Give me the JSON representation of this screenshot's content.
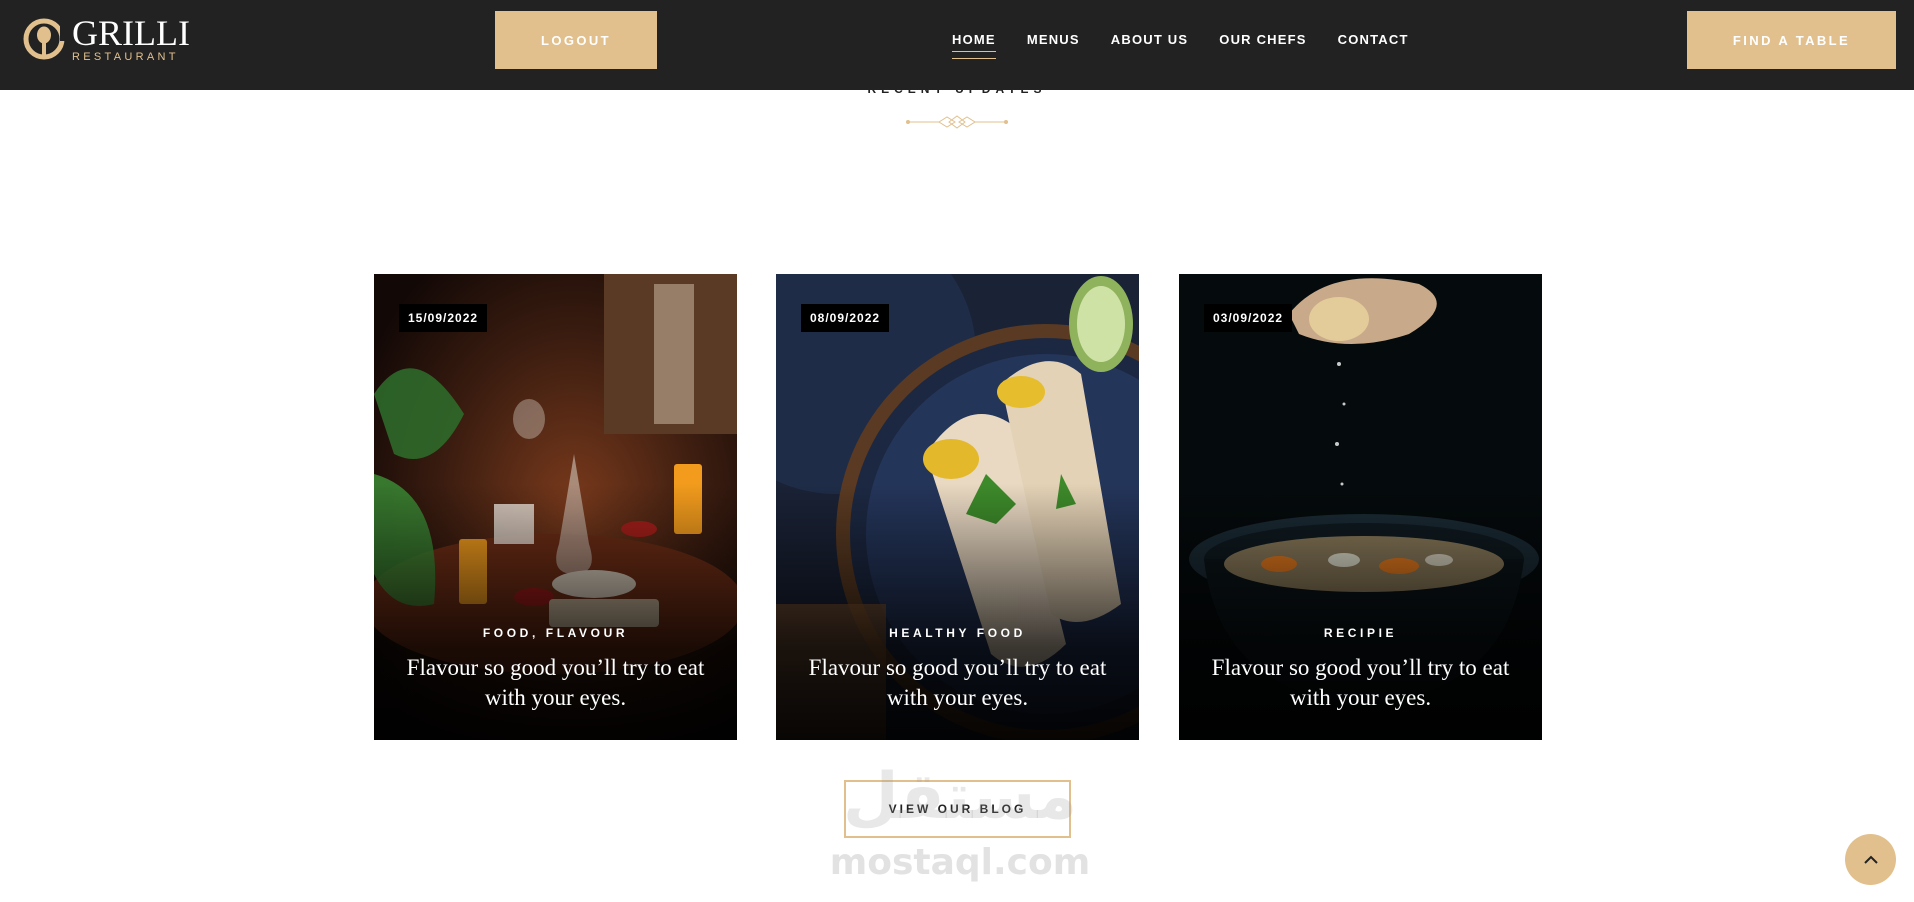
{
  "header": {
    "logo": {
      "name": "GRILLI",
      "subtitle": "RESTAURANT"
    },
    "logout_label": "LOGOUT",
    "nav": [
      {
        "label": "HOME",
        "active": true
      },
      {
        "label": "MENUS",
        "active": false
      },
      {
        "label": "ABOUT US",
        "active": false
      },
      {
        "label": "OUR CHEFS",
        "active": false
      },
      {
        "label": "CONTACT",
        "active": false
      }
    ],
    "find_table_label": "FIND A TABLE"
  },
  "section": {
    "title": "RECENT UPDATES"
  },
  "cards": [
    {
      "date": "15/09/2022",
      "category": "FOOD, FLAVOUR",
      "title": "Flavour so good you’ll try to eat with your eyes.",
      "image_icon": "restaurant-table-photo"
    },
    {
      "date": "08/09/2022",
      "category": "HEALTHY FOOD",
      "title": "Flavour so good you’ll try to eat with your eyes.",
      "image_icon": "wraps-plate-photo"
    },
    {
      "date": "03/09/2022",
      "category": "RECIPIE",
      "title": "Flavour so good you’ll try to eat with your eyes.",
      "image_icon": "soup-bowl-photo"
    }
  ],
  "view_blog_label": "VIEW OUR BLOG",
  "watermark": {
    "arabic": "مستقل",
    "text": "mostaql.com"
  },
  "scroll_top_icon": "chevron-up-icon",
  "colors": {
    "gold": "#e1c08e",
    "header_bg": "#222222",
    "text_dark": "#222222"
  }
}
